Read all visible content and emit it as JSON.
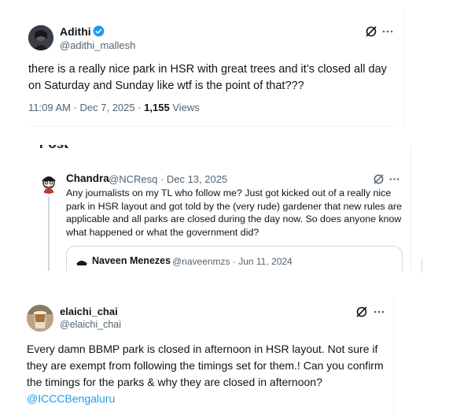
{
  "tweet1": {
    "name": "Adithi",
    "handle": "@adithi_mallesh",
    "text": "there is a really nice park in HSR with great trees and it’s closed all day on Saturday and Sunday like wtf is the point of that???",
    "time": "11:09 AM · Dec 7, 2025 · ",
    "views_count": "1,155",
    "views_label": " Views",
    "icons": [
      "grok-icon",
      "more-icon"
    ],
    "verified_color": "#1d9bf0"
  },
  "tweet2": {
    "header_partial": "Post",
    "name": "Chandra",
    "handle_date": "@NCResq · Dec 13, 2025",
    "text": "Any journalists on my TL who follow me? Just got kicked out of a really nice park in HSR layout and got told by the (very rude) gardener that new rules are applicable and all parks are closed during the day now. So does anyone know what happened or what the government did?",
    "quoted": {
      "name": "Naveen Menezes",
      "handle_date": "@naveenmzs · Jun 11, 2024"
    }
  },
  "tweet3": {
    "name": "elaichi_chai",
    "handle": "@elaichi_chai",
    "text": "Every damn BBMP park is closed in afternoon in HSR layout. Not sure if they are exempt from following the timings set for them.! Can you confirm the timings for the parks & why they are closed in afternoon?",
    "mention": "@ICCCBengaluru",
    "link_color": "#1d9bf0"
  }
}
